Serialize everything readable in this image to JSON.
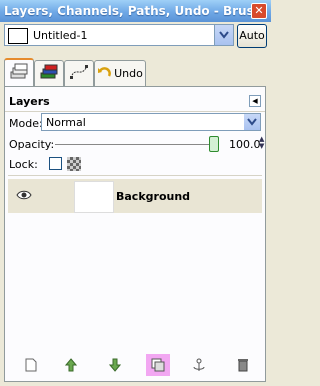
{
  "window": {
    "title": "Layers, Channels, Paths, Undo - Brushes, P..."
  },
  "image_selector": {
    "value": "Untitled-1",
    "auto_label": "Auto"
  },
  "tabs": {
    "undo_label": "Undo"
  },
  "layers_panel": {
    "heading": "Layers",
    "mode_label": "Mode:",
    "mode_value": "Normal",
    "opacity_label": "Opacity:",
    "opacity_value": "100.0",
    "lock_label": "Lock:"
  },
  "layers": [
    {
      "name": "Background",
      "visible": true
    }
  ],
  "colors": {
    "accent_tab": "#e68b2c",
    "selected_row": "#e9e5d4",
    "highlight_button": "#f2a7f2"
  }
}
